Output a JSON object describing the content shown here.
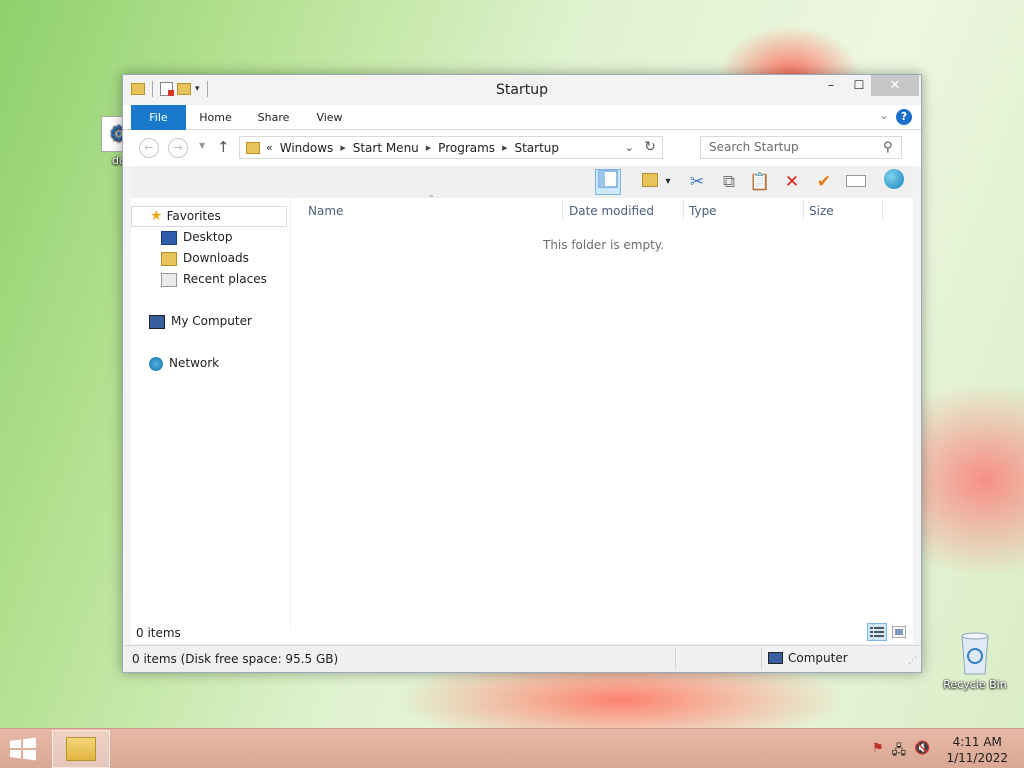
{
  "desktop": {
    "partial_icon_label": "dd",
    "recycle_bin_label": "Recycle Bin"
  },
  "window": {
    "title": "Startup",
    "controls": {
      "minimize": "–",
      "maximize": "☐",
      "close": "✕"
    }
  },
  "ribbon": {
    "tabs": [
      "File",
      "Home",
      "Share",
      "View"
    ]
  },
  "address_bar": {
    "prefix": "«",
    "crumbs": [
      "Windows",
      "Start Menu",
      "Programs",
      "Startup"
    ]
  },
  "search": {
    "placeholder": "Search Startup"
  },
  "nav_pane": {
    "favorites": "Favorites",
    "desktop": "Desktop",
    "downloads": "Downloads",
    "recent_places": "Recent places",
    "computer": "My Computer",
    "network": "Network"
  },
  "columns": [
    "Name",
    "Date modified",
    "Type",
    "Size"
  ],
  "empty_message": "This folder is empty.",
  "items_count": "0 items",
  "status": {
    "left": "0 items (Disk free space: 95.5 GB)",
    "right": "Computer"
  },
  "taskbar": {
    "time": "4:11 AM",
    "date": "1/11/2022"
  },
  "colors": {
    "accent": "#1979ca",
    "selection": "#cde8ff"
  }
}
